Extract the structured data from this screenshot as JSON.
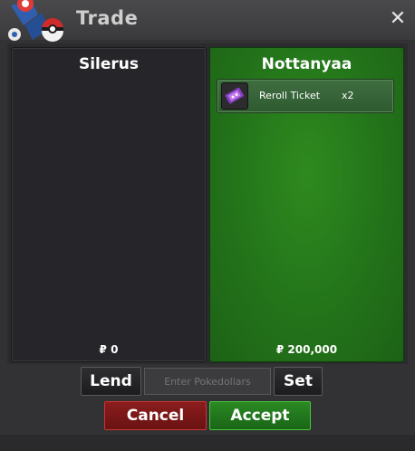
{
  "window": {
    "title": "Trade"
  },
  "left_panel": {
    "player_name": "Silerus",
    "money": "₽ 0"
  },
  "right_panel": {
    "player_name": "Nottanyaa",
    "money": "₽ 200,000",
    "items": [
      {
        "name": "Reroll Ticket",
        "quantity": "x2",
        "icon": "ticket-icon"
      }
    ]
  },
  "controls": {
    "lend_label": "Lend",
    "pokedollars_placeholder": "Enter Pokedollars",
    "set_label": "Set",
    "cancel_label": "Cancel",
    "accept_label": "Accept"
  },
  "colors": {
    "accept": "#2a8a23",
    "cancel": "#8b1d1d",
    "offer_panel": "#23731a"
  }
}
